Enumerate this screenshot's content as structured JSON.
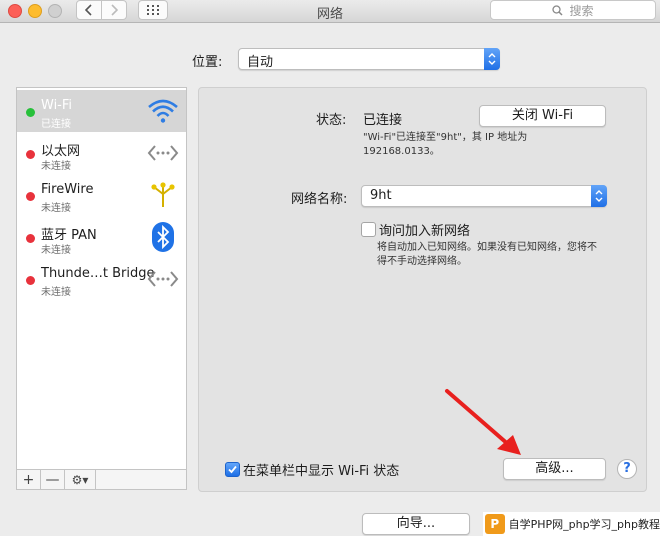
{
  "window": {
    "title": "网络"
  },
  "search": {
    "placeholder": "搜索"
  },
  "location": {
    "label": "位置:",
    "value": "自动"
  },
  "services": [
    {
      "name": "Wi-Fi",
      "status": "已连接",
      "dot_color": "#27c03a",
      "icon": "wifi-icon"
    },
    {
      "name": "以太网",
      "status": "未连接",
      "dot_color": "#e8323c",
      "icon": "ethernet-icon"
    },
    {
      "name": "FireWire",
      "status": "未连接",
      "dot_color": "#e8323c",
      "icon": "firewire-icon"
    },
    {
      "name": "蓝牙 PAN",
      "status": "未连接",
      "dot_color": "#e8323c",
      "icon": "bluetooth-icon"
    },
    {
      "name": "Thunde…t Bridge",
      "status": "未连接",
      "dot_color": "#e8323c",
      "icon": "thunderbolt-bridge-icon"
    }
  ],
  "sidebar_toolbar": {
    "add": "+",
    "remove": "—",
    "gear": "⚙▾"
  },
  "detail": {
    "status_label": "状态:",
    "status_value": "已连接",
    "wifi_off_button": "关闭 Wi-Fi",
    "status_desc_line1": "\"Wi-Fi\"已连接至\"9ht\"，其 IP 地址为",
    "status_desc_line2": "192168.0133。",
    "network_name_label": "网络名称:",
    "network_name_value": "9ht",
    "ask_join_label": "询问加入新网络",
    "ask_join_desc_line1": "将自动加入已知网络。如果没有已知网络，您将不",
    "ask_join_desc_line2": "得不手动选择网络。",
    "show_menubar_label": "在菜单栏中显示 Wi-Fi 状态",
    "advanced_button": "高级...",
    "help": "?"
  },
  "bottom": {
    "assist_button": "向导..."
  },
  "watermark": {
    "logo": "P",
    "text": "自学PHP网_php学习_php教程"
  },
  "colors": {
    "accent": "#1f6fe6",
    "arrow": "#e8201e",
    "active_row": "#d6d6d6"
  }
}
